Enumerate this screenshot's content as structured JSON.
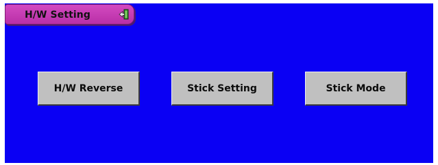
{
  "window": {
    "title": "H/W Setting",
    "exit_icon": "exit-door-icon"
  },
  "buttons": {
    "hw_reverse": "H/W Reverse",
    "stick_setting": "Stick Setting",
    "stick_mode": "Stick Mode"
  },
  "colors": {
    "background": "#0a00f4",
    "title_tab": "#c63bb4",
    "button_face": "#c0c0c0"
  }
}
